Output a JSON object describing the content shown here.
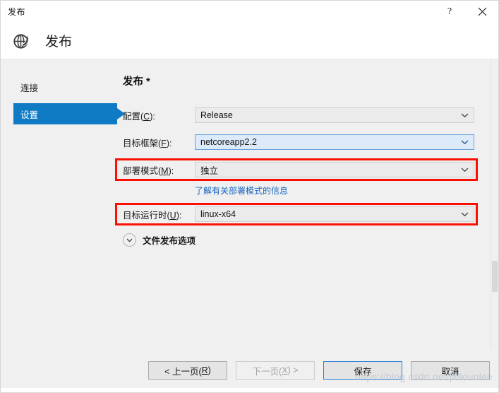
{
  "window": {
    "titlebar_text": "发布",
    "help_icon": "question-mark-icon",
    "close_icon": "close-icon"
  },
  "header": {
    "icon": "globe-publish-icon",
    "title": "发布"
  },
  "sidebar": {
    "items": [
      {
        "label": "连接",
        "selected": false
      },
      {
        "label": "设置",
        "selected": true
      }
    ]
  },
  "main": {
    "section_title": "发布 *",
    "fields": [
      {
        "label_prefix": "配置(",
        "label_accel": "C",
        "label_suffix": "):",
        "value": "Release",
        "state": "normal",
        "highlighted": false
      },
      {
        "label_prefix": "目标框架(",
        "label_accel": "F",
        "label_suffix": "):",
        "value": "netcoreapp2.2",
        "state": "active",
        "highlighted": false
      },
      {
        "label_prefix": "部署模式(",
        "label_accel": "M",
        "label_suffix": "):",
        "value": "独立",
        "state": "normal",
        "highlighted": true
      },
      {
        "label_prefix": "目标运行时(",
        "label_accel": "U",
        "label_suffix": "):",
        "value": "linux-x64",
        "state": "normal",
        "highlighted": true
      }
    ],
    "hint_link": "了解有关部署模式的信息",
    "expander": {
      "label": "文件发布选项",
      "icon": "chevron-down-icon",
      "expanded": false
    }
  },
  "footer": {
    "buttons": [
      {
        "prefix": "< 上一页(",
        "accel": "R",
        "suffix": ")",
        "state": "normal"
      },
      {
        "prefix": "下一页(",
        "accel": "X",
        "suffix": ") >",
        "state": "disabled"
      },
      {
        "prefix": "保存",
        "accel": "",
        "suffix": "",
        "state": "default"
      },
      {
        "prefix": "取消",
        "accel": "",
        "suffix": "",
        "state": "normal"
      }
    ],
    "watermark": "https://blog.csdn.net/jielounlee"
  },
  "colors": {
    "accent_blue": "#0f7bc4",
    "link_blue": "#1866c0",
    "annotation_red": "#fa0f00",
    "dialog_bg": "#f0f0f0",
    "header_bg": "#ffffff"
  }
}
